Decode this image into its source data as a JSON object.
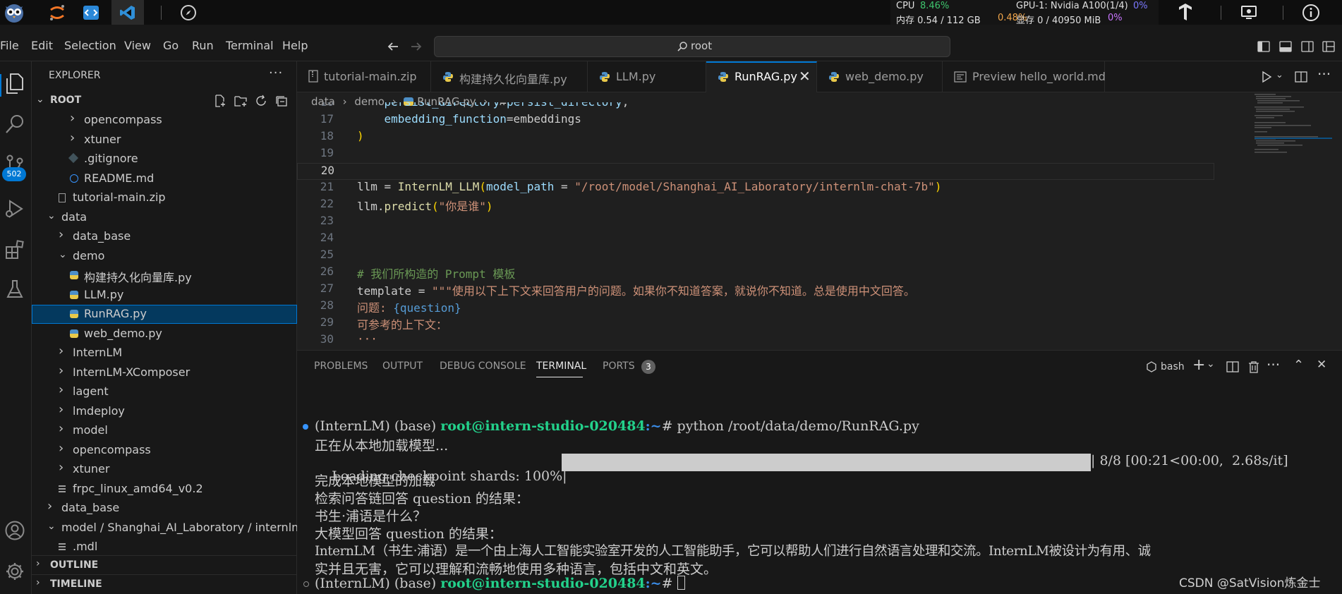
{
  "topbar": {
    "cpu_label": "CPU",
    "cpu_value": "8.46%",
    "mem_label": "内存 0.54 / 112 GB",
    "mem_value": "0.48%",
    "gpu_label": "GPU-1: Nvidia A100(1/4)",
    "gpu_value": "0%",
    "vram_label": "显存 0 / 40950 MiB",
    "vram_value": "0%"
  },
  "menu": [
    "File",
    "Edit",
    "Selection",
    "View",
    "Go",
    "Run",
    "Terminal",
    "Help"
  ],
  "search": {
    "value": "root"
  },
  "activity": {
    "badge": "502"
  },
  "sidebar": {
    "title": "EXPLORER",
    "root_label": "ROOT",
    "items": [
      {
        "label": "opencompass",
        "type": "folder",
        "expanded": false,
        "depth": 2
      },
      {
        "label": "xtuner",
        "type": "folder",
        "expanded": false,
        "depth": 2
      },
      {
        "label": ".gitignore",
        "type": "git",
        "depth": 2
      },
      {
        "label": "README.md",
        "type": "info",
        "depth": 2
      },
      {
        "label": "tutorial-main.zip",
        "type": "zip",
        "depth": 1
      },
      {
        "label": "data",
        "type": "folder",
        "expanded": true,
        "depth": 0
      },
      {
        "label": "data_base",
        "type": "folder",
        "expanded": false,
        "depth": 1
      },
      {
        "label": "demo",
        "type": "folder",
        "expanded": true,
        "depth": 1
      },
      {
        "label": "构建持久化向量库.py",
        "type": "py",
        "depth": 2
      },
      {
        "label": "LLM.py",
        "type": "py",
        "depth": 2
      },
      {
        "label": "RunRAG.py",
        "type": "py",
        "depth": 2,
        "selected": true
      },
      {
        "label": "web_demo.py",
        "type": "py",
        "depth": 2
      },
      {
        "label": "InternLM",
        "type": "folder",
        "expanded": false,
        "depth": 1
      },
      {
        "label": "InternLM-XComposer",
        "type": "folder",
        "expanded": false,
        "depth": 1
      },
      {
        "label": "lagent",
        "type": "folder",
        "expanded": false,
        "depth": 1
      },
      {
        "label": "lmdeploy",
        "type": "folder",
        "expanded": false,
        "depth": 1
      },
      {
        "label": "model",
        "type": "folder",
        "expanded": false,
        "depth": 1
      },
      {
        "label": "opencompass",
        "type": "folder",
        "expanded": false,
        "depth": 1
      },
      {
        "label": "xtuner",
        "type": "folder",
        "expanded": false,
        "depth": 1
      },
      {
        "label": "frpc_linux_amd64_v0.2",
        "type": "file",
        "depth": 1
      },
      {
        "label": "data_base",
        "type": "folder",
        "expanded": false,
        "depth": 0
      },
      {
        "label": "model / Shanghai_AI_Laboratory / internlm-c...",
        "type": "folder",
        "expanded": true,
        "depth": 0
      },
      {
        "label": ".mdl",
        "type": "file",
        "depth": 1
      }
    ],
    "outline_label": "OUTLINE",
    "timeline_label": "TIMELINE"
  },
  "tabs": [
    {
      "label": "tutorial-main.zip",
      "icon": "zip-file-icon"
    },
    {
      "label": "构建持久化向量库.py",
      "icon": "python-file-icon"
    },
    {
      "label": "LLM.py",
      "icon": "python-file-icon"
    },
    {
      "label": "RunRAG.py",
      "icon": "python-file-icon",
      "active": true
    },
    {
      "label": "web_demo.py",
      "icon": "python-file-icon"
    },
    {
      "label": "Preview hello_world.md",
      "icon": "preview-icon"
    }
  ],
  "breadcrumb": [
    "data",
    "demo",
    "RunRAG.py",
    "..."
  ],
  "editor": {
    "lines": [
      {
        "n": "16",
        "segs": [
          [
            "    ",
            "p"
          ],
          [
            "persist_directory",
            "v"
          ],
          [
            "=",
            "p"
          ],
          [
            "persist_directory",
            "v"
          ],
          [
            ",",
            "p"
          ]
        ]
      },
      {
        "n": "17",
        "segs": [
          [
            "    ",
            "p"
          ],
          [
            "embedding_function",
            "v"
          ],
          [
            "=embeddings",
            "p"
          ]
        ]
      },
      {
        "n": "18",
        "segs": [
          [
            ")",
            "y"
          ]
        ]
      },
      {
        "n": "19",
        "segs": []
      },
      {
        "n": "20",
        "segs": [],
        "current": true
      },
      {
        "n": "21",
        "segs": [
          [
            "llm = ",
            "p"
          ],
          [
            "InternLM_LLM",
            "f"
          ],
          [
            "(",
            "y"
          ],
          [
            "model_path",
            "v"
          ],
          [
            " = ",
            "p"
          ],
          [
            "\"/root/model/Shanghai_AI_Laboratory/internlm-chat-7b\"",
            "s"
          ],
          [
            ")",
            "y"
          ]
        ]
      },
      {
        "n": "22",
        "segs": [
          [
            "llm.",
            "p"
          ],
          [
            "predict",
            "f"
          ],
          [
            "(",
            "y"
          ],
          [
            "\"你是谁\"",
            "s"
          ],
          [
            ")",
            "y"
          ]
        ]
      },
      {
        "n": "23",
        "segs": []
      },
      {
        "n": "24",
        "segs": []
      },
      {
        "n": "25",
        "segs": []
      },
      {
        "n": "26",
        "segs": [
          [
            "# 我们所构造的 Prompt 模板",
            "c"
          ]
        ]
      },
      {
        "n": "27",
        "segs": [
          [
            "template = ",
            "p"
          ],
          [
            "\"\"\"使用以下上下文来回答用户的问题。如果你不知道答案，就说你不知道。总是使用中文回答。",
            "s"
          ]
        ]
      },
      {
        "n": "28",
        "segs": [
          [
            "问题: ",
            "s"
          ],
          [
            "{question}",
            "b"
          ]
        ]
      },
      {
        "n": "29",
        "segs": [
          [
            "可参考的上下文：",
            "s"
          ]
        ]
      },
      {
        "n": "30",
        "segs": [
          [
            "···",
            "s"
          ]
        ]
      }
    ]
  },
  "panel": {
    "tabs": [
      "PROBLEMS",
      "OUTPUT",
      "DEBUG CONSOLE",
      "TERMINAL",
      "PORTS"
    ],
    "ports_count": "3",
    "shell": "bash",
    "terminal": {
      "prompt_env": "(InternLM) (base) ",
      "prompt_user": "root@intern-studio-020484",
      "prompt_path": ":~",
      "command": "# python /root/data/demo/RunRAG.py",
      "line1": "正在从本地加载模型...",
      "progress_label": "Loading checkpoint shards: 100%|",
      "progress_percent": 100,
      "progress_stats": "| 8/8 [00:21<00:00,  2.68s/it]",
      "line3": "完成本地模型的加载",
      "line4": "检索问答链回答 question 的结果：",
      "line5": "书生·浦语是什么？",
      "line6": "大模型回答 question 的结果：",
      "line7": "InternLM（书生·浦语）是一个由上海人工智能实验室开发的人工智能助手，它可以帮助人们进行自然语言处理和交流。InternLM被设计为有用、诚",
      "line8": "实并且无害，它可以理解和流畅地使用多种语言，包括中文和英文。",
      "final_command": "# "
    }
  },
  "watermark": "CSDN @SatVision炼金士",
  "colors": {
    "accent": "#0078d4",
    "string": "#ce9178",
    "comment": "#6a9955",
    "variable": "#9cdcfe",
    "function": "#dcdcaa",
    "prompt_green": "#23d18b"
  }
}
